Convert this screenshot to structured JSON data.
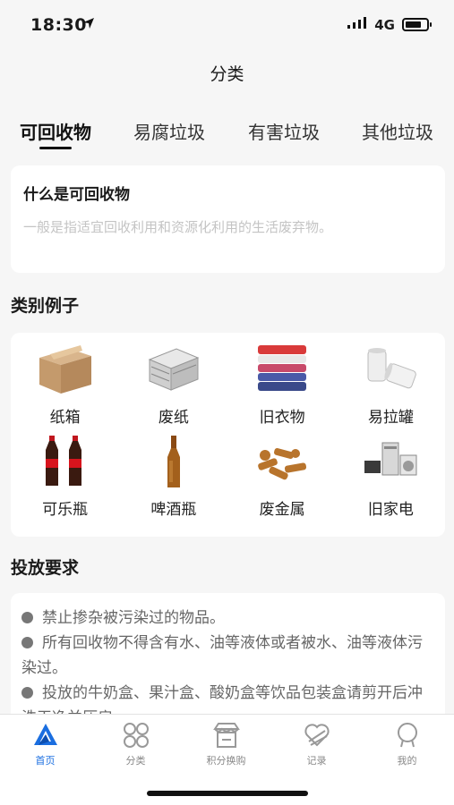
{
  "status_bar": {
    "time": "18:30",
    "network": "4G"
  },
  "nav": {
    "title": "分类"
  },
  "tabs": [
    {
      "label": "可回收物",
      "active": true
    },
    {
      "label": "易腐垃圾",
      "active": false
    },
    {
      "label": "有害垃圾",
      "active": false
    },
    {
      "label": "其他垃圾",
      "active": false
    }
  ],
  "definition": {
    "title": "什么是可回收物",
    "description": "一般是指适宜回收利用和资源化利用的生活废弃物。"
  },
  "examples": {
    "title": "类别例子",
    "items": [
      {
        "label": "纸箱",
        "icon": "cardboard-box-icon"
      },
      {
        "label": "废纸",
        "icon": "waste-paper-icon"
      },
      {
        "label": "旧衣物",
        "icon": "old-clothes-icon"
      },
      {
        "label": "易拉罐",
        "icon": "can-icon"
      },
      {
        "label": "可乐瓶",
        "icon": "cola-bottle-icon"
      },
      {
        "label": "啤酒瓶",
        "icon": "beer-bottle-icon"
      },
      {
        "label": "废金属",
        "icon": "scrap-metal-icon"
      },
      {
        "label": "旧家电",
        "icon": "appliances-icon"
      }
    ]
  },
  "requirements": {
    "title": "投放要求",
    "rules": [
      "禁止掺杂被污染过的物品。",
      "所有回收物不得含有水、油等液体或者被水、油等液体污染过。",
      "投放的牛奶盒、果汁盒、酸奶盒等饮品包装盒请剪开后冲洗干净并压扁。"
    ]
  },
  "tabbar": [
    {
      "label": "首页",
      "icon": "home-triangle-icon",
      "active": true
    },
    {
      "label": "分类",
      "icon": "category-grid-icon",
      "active": false
    },
    {
      "label": "积分换购",
      "icon": "shop-icon",
      "active": false
    },
    {
      "label": "记录",
      "icon": "record-icon",
      "active": false
    },
    {
      "label": "我的",
      "icon": "profile-icon",
      "active": false
    }
  ],
  "colors": {
    "accent": "#1a6ee0",
    "background": "#f6f6f6"
  }
}
